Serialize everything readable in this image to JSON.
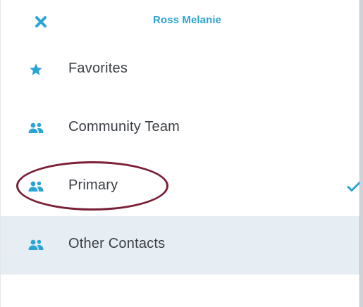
{
  "header": {
    "title": "Ross Melanie",
    "close_icon": "close-icon"
  },
  "groups": [
    {
      "label": "Favorites",
      "icon": "star-icon",
      "selected": false,
      "highlighted": false
    },
    {
      "label": "Community Team",
      "icon": "people-icon",
      "selected": false,
      "highlighted": false
    },
    {
      "label": "Primary",
      "icon": "people-icon",
      "selected": true,
      "highlighted": false
    },
    {
      "label": "Other Contacts",
      "icon": "people-icon",
      "selected": false,
      "highlighted": true
    }
  ],
  "colors": {
    "accent": "#2aa4d6",
    "text": "#3a3f45",
    "highlight_background": "#e7eef3",
    "annotation": "#7a1f35"
  }
}
